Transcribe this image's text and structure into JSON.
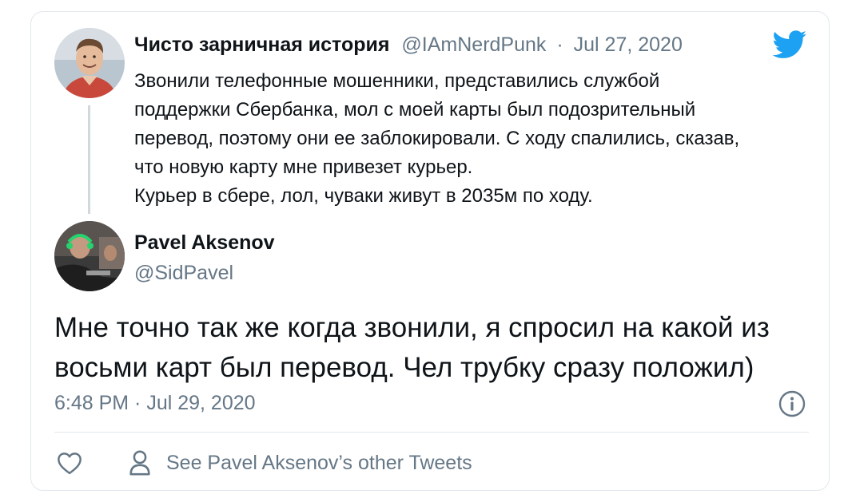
{
  "quoted_tweet": {
    "author_name": "Чисто зарничная история",
    "author_handle": "@IAmNerdPunk",
    "separator": "·",
    "date": "Jul 27, 2020",
    "text_lines": [
      "Звонили телефонные мошенники, представились службой",
      "поддержки Сбербанка, мол с моей карты был подозрительный",
      "перевод, поэтому они ее заблокировали. С ходу спалились, сказав,",
      "что новую карту мне привезет курьер.",
      "Курьер в сбере, лол, чуваки живут в 2035м по ходу."
    ]
  },
  "reply_tweet": {
    "author_name": "Pavel Aksenov",
    "author_handle": "@SidPavel",
    "text_lines": [
      "Мне точно так же когда звонили, я спросил на какой из",
      "восьми карт был перевод. Чел трубку сразу положил)"
    ],
    "timestamp": "6:48 PM · Jul 29, 2020"
  },
  "actions": {
    "see_other_tweets_label": "See Pavel Aksenov’s other Tweets"
  },
  "icons": {
    "brand": "twitter-bird-icon",
    "info": "info-icon",
    "like": "heart-icon",
    "profile": "person-icon"
  },
  "colors": {
    "twitter_blue": "#1da1f2",
    "secondary_text": "#657786",
    "border": "#e1e8ed",
    "thread_line": "#cfd9de"
  }
}
